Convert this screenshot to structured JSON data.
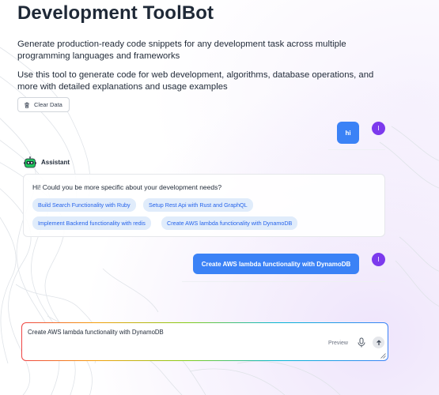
{
  "app": {
    "title": "Development ToolBot",
    "description_1": "Generate production-ready code snippets for any development task across multiple programming languages and frameworks",
    "description_2": "Use this tool to generate code for web development, algorithms, database operations, and more with detailed explanations and usage examples"
  },
  "toolbar": {
    "clear_label": "Clear Data",
    "clear_icon": "trash-icon"
  },
  "chat": {
    "user_avatar_initial": "I",
    "messages": [
      {
        "role": "user",
        "text": "hi"
      },
      {
        "role": "assistant",
        "sender": "Assistant",
        "text": "Hi! Could you be more specific about your development needs?",
        "suggestions": [
          "Build Search Functionality with Ruby",
          "Setup Rest Api with Rust and GraphQL",
          "Implement Backend functionality with redis",
          "Create AWS lambda functionality with DynamoDB"
        ]
      },
      {
        "role": "user",
        "text": "Create AWS lambda functionality with DynamoDB"
      }
    ]
  },
  "composer": {
    "value": "Create AWS lambda functionality with DynamoDB",
    "preview_label": "Preview",
    "mic_icon": "microphone-icon",
    "send_icon": "arrow-up-icon"
  },
  "colors": {
    "accent": "#3b82f6",
    "avatar": "#7c3aed",
    "chip_bg": "#e0ecfb",
    "chip_text": "#2563eb",
    "bot_icon": "#22c55e"
  }
}
